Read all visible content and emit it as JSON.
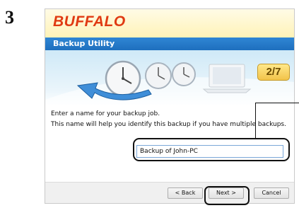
{
  "step": {
    "number": "3"
  },
  "brand": {
    "logo_text": "BUFFALO"
  },
  "window": {
    "title": "Backup Utility"
  },
  "wizard": {
    "progress_label": "2/7"
  },
  "content": {
    "instruction": "Enter a name for your backup job.",
    "hint": "This name will help you identify this backup if you have multiple backups.",
    "backup_name_value": "Backup of John-PC"
  },
  "buttons": {
    "back": "< Back",
    "next": "Next >",
    "cancel": "Cancel"
  },
  "colors": {
    "brand_red": "#e03a12",
    "title_blue": "#1e6fbe",
    "badge_gold": "#f2c34a"
  },
  "icons": {
    "banner": [
      "clock-icon",
      "clock-icon",
      "clock-icon",
      "sync-arrow-icon",
      "laptop-icon"
    ]
  }
}
